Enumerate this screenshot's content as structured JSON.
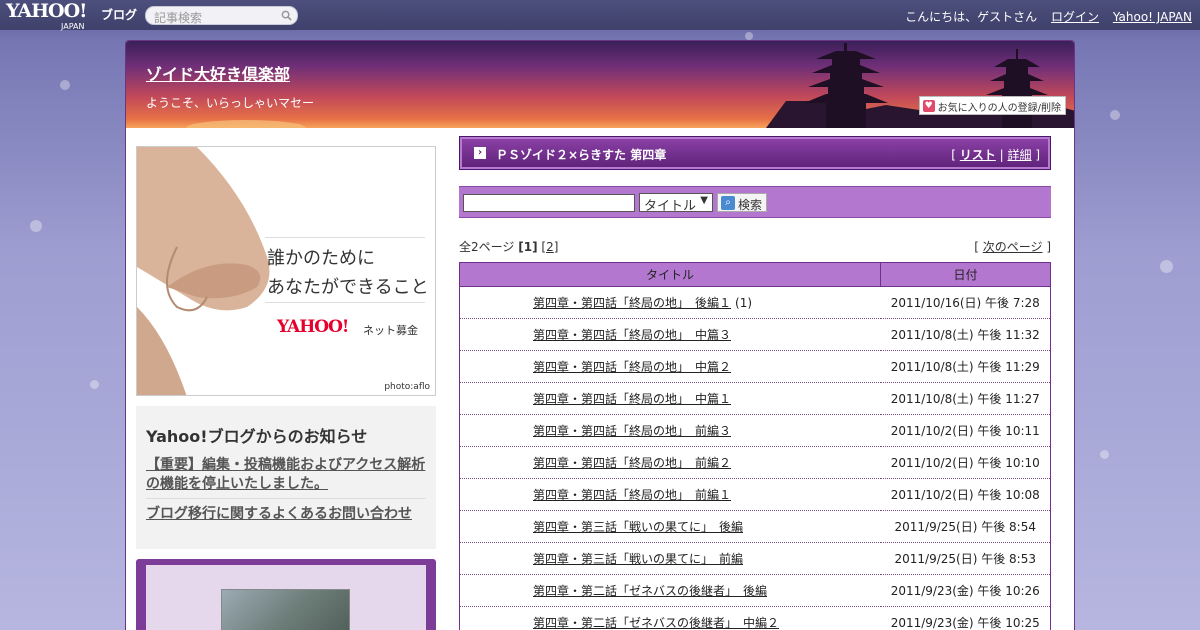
{
  "topbar": {
    "logo": "YAHOO!",
    "logo_sub": "JAPAN",
    "logo_blog": "ブログ",
    "search_placeholder": "記事検索",
    "greeting": "こんにちは、ゲストさん",
    "login": "ログイン",
    "yahoo_japan": "Yahoo! JAPAN"
  },
  "header": {
    "blog_title": "ゾイド大好き倶楽部",
    "subtitle": "ようこそ、いらっしゃいマセー",
    "fav_button": "お気に入りの人の登録/削除"
  },
  "banner": {
    "line1": "誰かのために",
    "line2": "あなたができること",
    "logo": "YAHOO!",
    "logo_sub": "ネット募金",
    "credit": "photo:aflo"
  },
  "notice": {
    "heading": "Yahoo!ブログからのお知らせ",
    "links": [
      "【重要】編集・投稿機能およびアクセス解析の機能を停止いたしました。",
      "ブログ移行に関するよくあるお問い合わせ"
    ]
  },
  "folder": {
    "title": "ＰＳゾイド２×らきすた 第四章",
    "list": "リスト",
    "detail": "詳細"
  },
  "search": {
    "select_value": "タイトル",
    "button": "検索"
  },
  "pager": {
    "total": "全2ページ",
    "page1": "1",
    "page2": "2",
    "next": "次のページ"
  },
  "table": {
    "col_title": "タイトル",
    "col_date": "日付",
    "rows": [
      {
        "title": "第四章・第四話「終局の地」　後編１",
        "extra": "(1)",
        "date": "2011/10/16(日) 午後 7:28"
      },
      {
        "title": "第四章・第四話「終局の地」　中篇３",
        "extra": "",
        "date": "2011/10/8(土) 午後 11:32"
      },
      {
        "title": "第四章・第四話「終局の地」　中篇２",
        "extra": "",
        "date": "2011/10/8(土) 午後 11:29"
      },
      {
        "title": "第四章・第四話「終局の地」　中篇１",
        "extra": "",
        "date": "2011/10/8(土) 午後 11:27"
      },
      {
        "title": "第四章・第四話「終局の地」　前編３",
        "extra": "",
        "date": "2011/10/2(日) 午後 10:11"
      },
      {
        "title": "第四章・第四話「終局の地」　前編２",
        "extra": "",
        "date": "2011/10/2(日) 午後 10:10"
      },
      {
        "title": "第四章・第四話「終局の地」　前編１",
        "extra": "",
        "date": "2011/10/2(日) 午後 10:08"
      },
      {
        "title": "第四章・第三話「戦いの果てに」　後編",
        "extra": "",
        "date": "2011/9/25(日) 午後 8:54"
      },
      {
        "title": "第四章・第三話「戦いの果てに」　前編",
        "extra": "",
        "date": "2011/9/25(日) 午後 8:53"
      },
      {
        "title": "第四章・第二話「ゼネバスの後継者」　後編",
        "extra": "",
        "date": "2011/9/23(金) 午後 10:26"
      },
      {
        "title": "第四章・第二話「ゼネバスの後継者」　中編２",
        "extra": "",
        "date": "2011/9/23(金) 午後 10:25"
      }
    ]
  },
  "colors": {
    "accent": "#b477cf",
    "header_dark": "#5d2278",
    "topbar": "#4d4f7c"
  }
}
